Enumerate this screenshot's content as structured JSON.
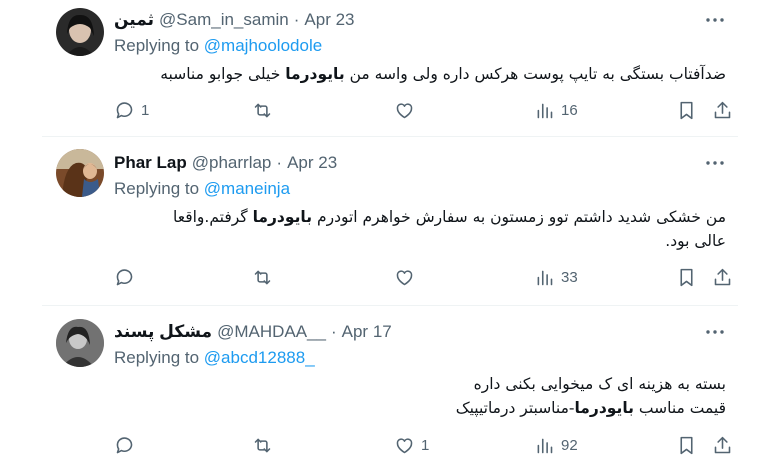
{
  "tweets": [
    {
      "name": "ثمین",
      "handle": "@Sam_in_samin",
      "date": "Apr 23",
      "replying_prefix": "Replying to",
      "replying_to": "@majhoolodole",
      "body_parts": [
        "ضدآفتاب بستگی به تایپ پوست هرکس داره ولی واسه من ",
        "بایودرما",
        " خیلی جوابو مناسبه"
      ],
      "replies": "1",
      "retweets": "",
      "likes": "",
      "views": "16",
      "avatar_color": "#2a2a2a"
    },
    {
      "name": "Phar Lap",
      "handle": "@pharrlap",
      "date": "Apr 23",
      "replying_prefix": "Replying to",
      "replying_to": "@maneinja",
      "body_line1_parts": [
        "من خشکی شدید داشتم توو زمستون به سفارش خواهرم اتودرم ",
        "بایودرما",
        " گرفتم.واقعا"
      ],
      "body_line2": "عالی بود.",
      "replies": "",
      "retweets": "",
      "likes": "",
      "views": "33",
      "avatar_color": "#7a4a2a"
    },
    {
      "name": "مشکل پسند",
      "handle": "@MAHDAA__",
      "date": "Apr 17",
      "replying_prefix": "Replying to",
      "replying_to": "@abcd12888_",
      "body_line1": "بسته به هزینه ای ک میخوایی بکنی داره",
      "body_line2_parts": [
        "قیمت مناسب ",
        "بایودرما",
        "-مناسبتر درماتیپیک"
      ],
      "replies": "",
      "retweets": "",
      "likes": "1",
      "views": "92",
      "avatar_color": "#5a5a5a"
    }
  ]
}
